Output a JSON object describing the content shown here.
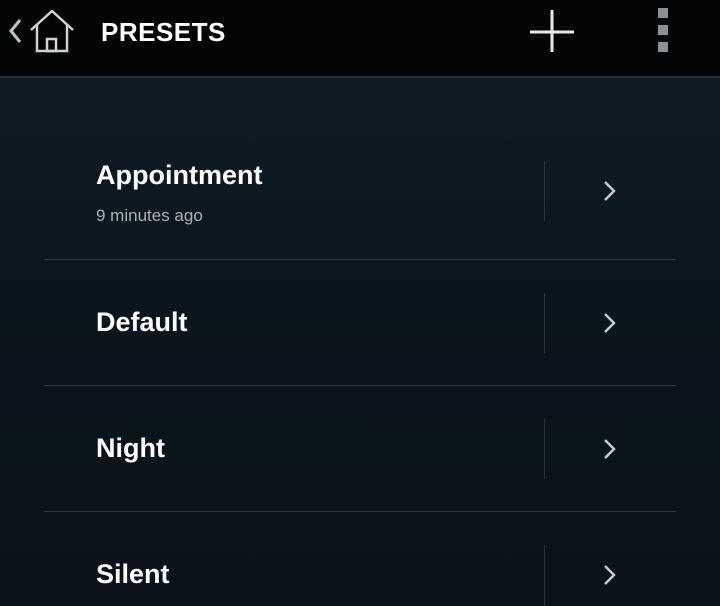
{
  "actionbar": {
    "title": "PRESETS",
    "up_icon": "home-icon",
    "add_icon": "plus-icon",
    "overflow_icon": "overflow-menu-icon"
  },
  "presets": [
    {
      "name": "Appointment",
      "subtitle": "9 minutes ago"
    },
    {
      "name": "Default",
      "subtitle": ""
    },
    {
      "name": "Night",
      "subtitle": ""
    },
    {
      "name": "Silent",
      "subtitle": ""
    }
  ],
  "colors": {
    "actionbar_bg": "#020405",
    "content_bg": "#0c141b",
    "text_primary": "#ffffff",
    "text_secondary": "#a9b0b5",
    "divider": "#2e363c"
  }
}
